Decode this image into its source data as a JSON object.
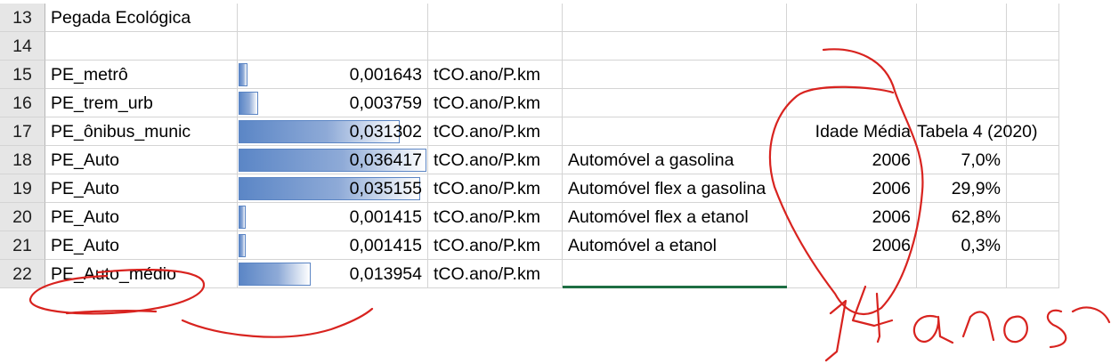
{
  "sheet": {
    "rows": [
      {
        "num": "13",
        "a": "Pegada Ecológica",
        "value": "",
        "value_ratio": 0,
        "unit": "",
        "desc": "",
        "year": "",
        "pct": ""
      },
      {
        "num": "14",
        "a": "",
        "value": "",
        "value_ratio": 0,
        "unit": "",
        "desc": "",
        "year": "",
        "pct": ""
      },
      {
        "num": "15",
        "a": "PE_metrô",
        "value": "0,001643",
        "value_ratio": 0.0451,
        "unit": "tCO.ano/P.km",
        "desc": "",
        "year": "",
        "pct": ""
      },
      {
        "num": "16",
        "a": "PE_trem_urb",
        "value": "0,003759",
        "value_ratio": 0.1032,
        "unit": "tCO.ano/P.km",
        "desc": "",
        "year": "",
        "pct": ""
      },
      {
        "num": "17",
        "a": "PE_ônibus_munic",
        "value": "0,031302",
        "value_ratio": 0.8595,
        "unit": "tCO.ano/P.km",
        "desc": "",
        "year": "Idade Média",
        "pct": "Tabela 4 (2020)"
      },
      {
        "num": "18",
        "a": "PE_Auto",
        "value": "0,036417",
        "value_ratio": 1.0,
        "unit": "tCO.ano/P.km",
        "desc": "Automóvel a gasolina",
        "year": "2006",
        "pct": "7,0%"
      },
      {
        "num": "19",
        "a": "PE_Auto",
        "value": "0,035155",
        "value_ratio": 0.9653,
        "unit": "tCO.ano/P.km",
        "desc": "Automóvel flex a gasolina",
        "year": "2006",
        "pct": "29,9%"
      },
      {
        "num": "20",
        "a": "PE_Auto",
        "value": "0,001415",
        "value_ratio": 0.0389,
        "unit": "tCO.ano/P.km",
        "desc": "Automóvel flex a etanol",
        "year": "2006",
        "pct": "62,8%"
      },
      {
        "num": "21",
        "a": "PE_Auto",
        "value": "0,001415",
        "value_ratio": 0.0389,
        "unit": "tCO.ano/P.km",
        "desc": "Automóvel a etanol",
        "year": "2006",
        "pct": "0,3%"
      },
      {
        "num": "22",
        "a": "PE_Auto_médio",
        "value": "0,013954",
        "value_ratio": 0.3832,
        "unit": "tCO.ano/P.km",
        "desc": "",
        "year": "",
        "pct": ""
      }
    ]
  },
  "annotation": {
    "handwriting_text": "14 anos",
    "ink_color": "#d8231f"
  }
}
